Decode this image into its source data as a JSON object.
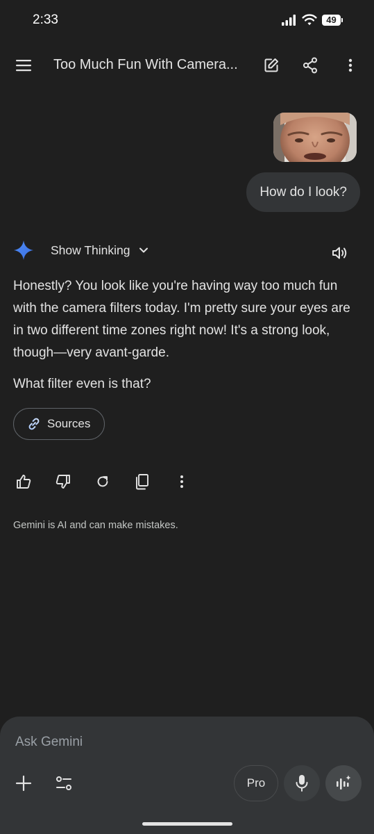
{
  "status_bar": {
    "time": "2:33",
    "battery": "49"
  },
  "header": {
    "title": "Too Much Fun With Camera...",
    "menu_icon": "menu-icon",
    "new_chat_icon": "edit-icon",
    "share_icon": "share-icon",
    "more_icon": "more-vert-icon"
  },
  "user_message": {
    "image_alt": "face-photo",
    "text": "How do I look?"
  },
  "model_response": {
    "show_thinking_label": "Show Thinking",
    "paragraph_1": "Honestly? You look like you're having way too much fun with the camera filters today. I'm pretty sure your eyes are in two different time zones right now! It's a strong look, though—very avant-garde.",
    "paragraph_2": "What filter even is that?",
    "sources_label": "Sources",
    "accent_color": "#4f8df9"
  },
  "actions": {
    "icons": [
      "thumb-up-icon",
      "thumb-down-icon",
      "redo-icon",
      "copy-icon",
      "more-vert-icon"
    ]
  },
  "disclaimer": "Gemini is AI and can make mistakes.",
  "composer": {
    "placeholder": "Ask Gemini",
    "value": "",
    "pro_label": "Pro"
  }
}
